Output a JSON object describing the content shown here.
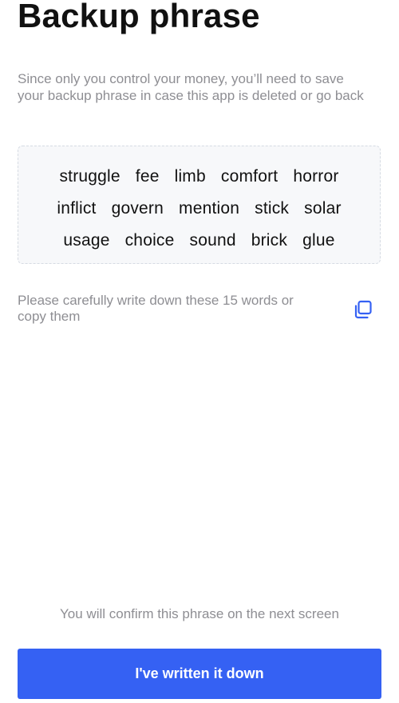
{
  "header": {
    "title": "Backup phrase"
  },
  "intro": {
    "text": "Since only you control your money, you’ll need to save your backup phrase in case this app is deleted or go back"
  },
  "phrase": {
    "rows": [
      [
        "struggle",
        "fee",
        "limb",
        "comfort",
        "horror"
      ],
      [
        "inflict",
        "govern",
        "mention",
        "stick",
        "solar"
      ],
      [
        "usage",
        "choice",
        "sound",
        "brick",
        "glue"
      ]
    ]
  },
  "instruction": {
    "text": "Please carefully write down these 15 words or copy them",
    "copy_icon": "copy-icon"
  },
  "footer": {
    "note": "You will confirm this phrase on the next screen",
    "button_label": "I've written it down"
  },
  "colors": {
    "accent": "#3561f3",
    "muted_text": "#8e8e93",
    "phrase_box_bg": "#f7f8fa",
    "phrase_box_border": "#d6dbe3"
  }
}
